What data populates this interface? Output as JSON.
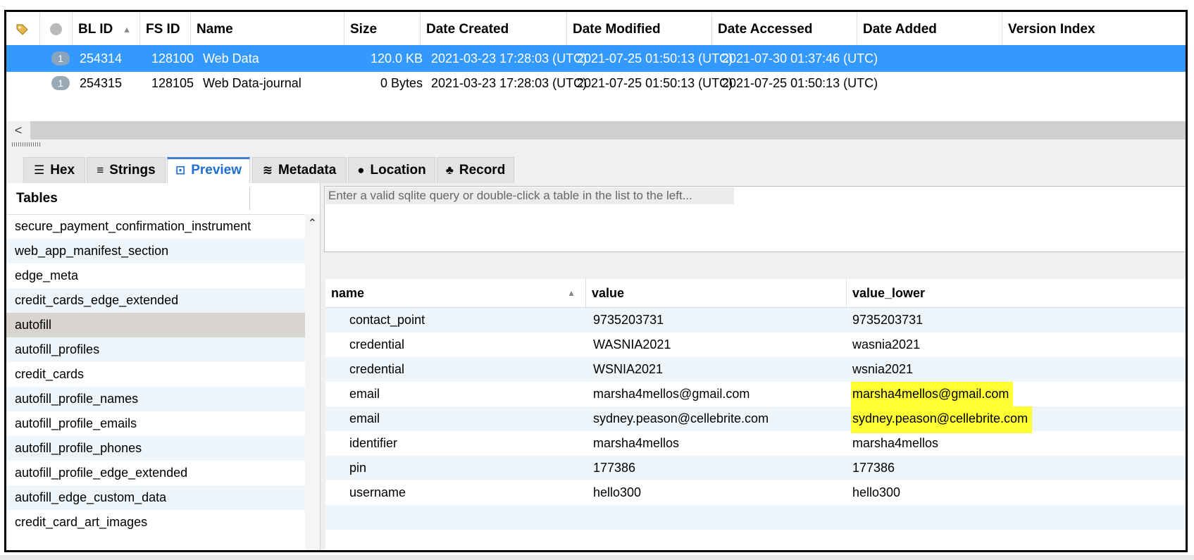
{
  "file_table": {
    "headers": [
      "BL ID",
      "FS ID",
      "Name",
      "Size",
      "Date Created",
      "Date Modified",
      "Date Accessed",
      "Date Added",
      "Version Index"
    ],
    "rows": [
      {
        "badge": "1",
        "bl_id": "254314",
        "fs_id": "128100",
        "name": "Web Data",
        "size": "120.0 KB",
        "date_created": "2021-03-23 17:28:03 (UTC)",
        "date_modified": "2021-07-25 01:50:13 (UTC)",
        "date_accessed": "2021-07-30 01:37:46 (UTC)"
      },
      {
        "badge": "1",
        "bl_id": "254315",
        "fs_id": "128105",
        "name": "Web Data-journal",
        "size": "0 Bytes",
        "date_created": "2021-03-23 17:28:03 (UTC)",
        "date_modified": "2021-07-25 01:50:13 (UTC)",
        "date_accessed": "2021-07-25 01:50:13 (UTC)"
      }
    ]
  },
  "scroll_left": "<",
  "tabs": [
    {
      "label": "Hex",
      "icon": "hex-icon"
    },
    {
      "label": "Strings",
      "icon": "strings-icon"
    },
    {
      "label": "Preview",
      "icon": "preview-icon"
    },
    {
      "label": "Metadata",
      "icon": "metadata-icon"
    },
    {
      "label": "Location",
      "icon": "location-pin-icon"
    },
    {
      "label": "Record",
      "icon": "record-icon"
    }
  ],
  "tables_pane": {
    "title": "Tables",
    "items": [
      "secure_payment_confirmation_instrument",
      "web_app_manifest_section",
      "edge_meta",
      "credit_cards_edge_extended",
      "autofill",
      "autofill_profiles",
      "credit_cards",
      "autofill_profile_names",
      "autofill_profile_emails",
      "autofill_profile_phones",
      "autofill_profile_edge_extended",
      "autofill_edge_custom_data",
      "credit_card_art_images"
    ],
    "selected": "autofill"
  },
  "query": {
    "placeholder": "Enter a valid sqlite query or double-click a table in the list to the left..."
  },
  "result_grid": {
    "headers": [
      "name",
      "value",
      "value_lower"
    ],
    "rows": [
      {
        "name": "contact_point",
        "value": "9735203731",
        "value_lower": "9735203731"
      },
      {
        "name": "credential",
        "value": "WASNIA2021",
        "value_lower": "wasnia2021"
      },
      {
        "name": "credential",
        "value": "WSNIA2021",
        "value_lower": "wsnia2021"
      },
      {
        "name": "email",
        "value": "marsha4mellos@gmail.com",
        "value_lower": "marsha4mellos@gmail.com"
      },
      {
        "name": "email",
        "value": "sydney.peason@cellebrite.com",
        "value_lower": "sydney.peason@cellebrite.com"
      },
      {
        "name": "identifier",
        "value": "marsha4mellos",
        "value_lower": "marsha4mellos"
      },
      {
        "name": "pin",
        "value": "177386",
        "value_lower": "177386"
      },
      {
        "name": "username",
        "value": "hello300",
        "value_lower": "hello300"
      }
    ],
    "highlight_color": "#ffff33"
  },
  "colors": {
    "selection": "#3399ff",
    "active_tab": "#1e6fd0",
    "highlight": "#ffff33"
  }
}
